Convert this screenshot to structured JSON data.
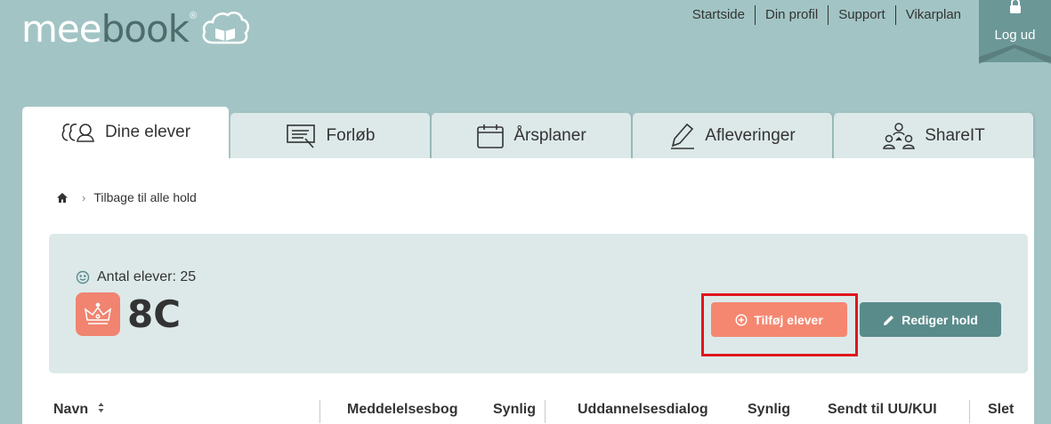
{
  "header": {
    "logo": {
      "part1": "mee",
      "part2": "book",
      "registered": "®"
    },
    "nav": [
      "Startside",
      "Din profil",
      "Support",
      "Vikarplan"
    ],
    "logout_label": "Log ud"
  },
  "tabs": [
    {
      "label": "Dine elever",
      "icon": "students-icon",
      "active": true
    },
    {
      "label": "Forløb",
      "icon": "course-icon",
      "active": false
    },
    {
      "label": "Årsplaner",
      "icon": "calendar-icon",
      "active": false
    },
    {
      "label": "Afleveringer",
      "icon": "pen-icon",
      "active": false
    },
    {
      "label": "ShareIT",
      "icon": "share-icon",
      "active": false
    }
  ],
  "breadcrumb": {
    "back_label": "Tilbage til alle hold"
  },
  "class_card": {
    "students_label": "Antal elever: 25",
    "class_name": "8C",
    "add_students_label": "Tilføj elever",
    "edit_team_label": "Rediger hold"
  },
  "table": {
    "columns": [
      "Navn",
      "Meddelelsesbog",
      "Synlig",
      "Uddannelsesdialog",
      "Synlig",
      "Sendt til UU/KUI",
      "Slet"
    ]
  },
  "colors": {
    "background": "#a2c4c4",
    "accent": "#f58770",
    "primary": "#5a8b8b",
    "card": "#dde9e9",
    "highlight": "#e0151d"
  }
}
